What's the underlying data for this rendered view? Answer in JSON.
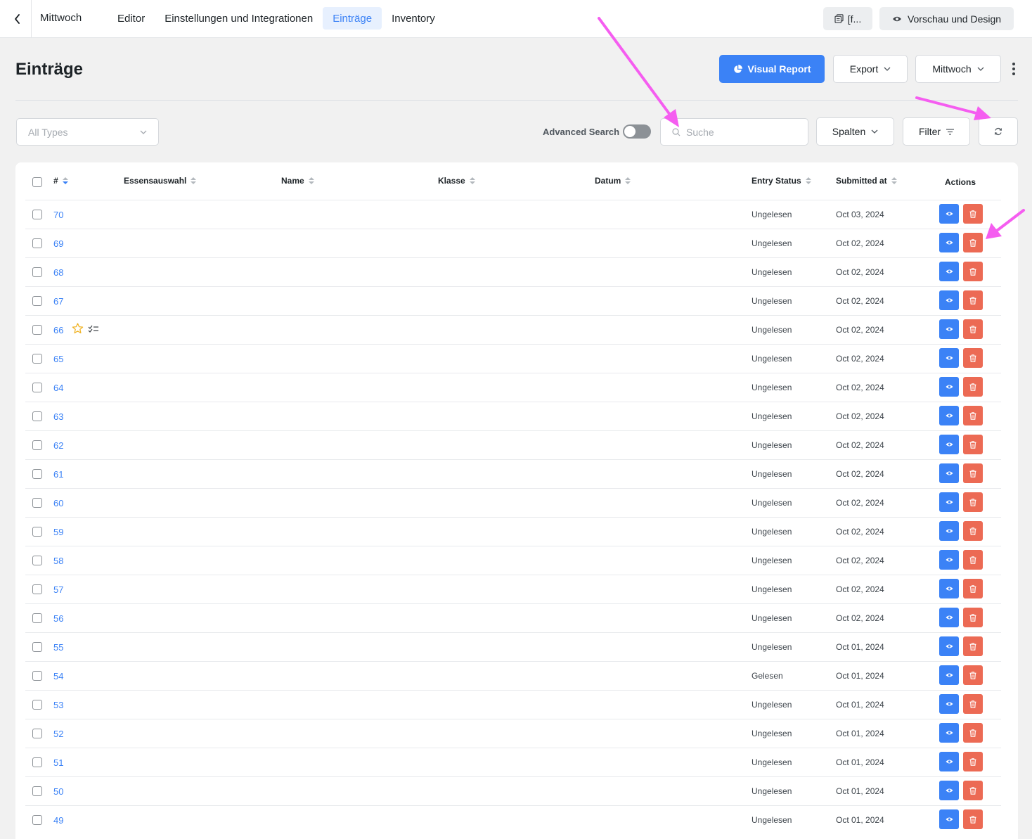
{
  "topbar": {
    "form_name": "Mittwoch",
    "nav": [
      {
        "label": "Editor",
        "active": false
      },
      {
        "label": "Einstellungen und Integrationen",
        "active": false
      },
      {
        "label": "Einträge",
        "active": true
      },
      {
        "label": "Inventory",
        "active": false
      }
    ],
    "shortcode_label": "[f...",
    "preview_label": "Vorschau und Design"
  },
  "header": {
    "title": "Einträge",
    "visual_report_label": "Visual Report",
    "export_label": "Export",
    "form_select_label": "Mittwoch"
  },
  "filters": {
    "types_placeholder": "All Types",
    "advanced_search_label": "Advanced Search",
    "search_placeholder": "Suche",
    "columns_label": "Spalten",
    "filter_label": "Filter"
  },
  "table": {
    "columns": {
      "id": "#",
      "essensauswahl": "Essensauswahl",
      "name": "Name",
      "klasse": "Klasse",
      "datum": "Datum",
      "entry_status": "Entry Status",
      "submitted_at": "Submitted at",
      "actions": "Actions"
    },
    "rows": [
      {
        "id": "70",
        "status": "Ungelesen",
        "submitted": "Oct 03, 2024"
      },
      {
        "id": "69",
        "status": "Ungelesen",
        "submitted": "Oct 02, 2024"
      },
      {
        "id": "68",
        "status": "Ungelesen",
        "submitted": "Oct 02, 2024"
      },
      {
        "id": "67",
        "status": "Ungelesen",
        "submitted": "Oct 02, 2024"
      },
      {
        "id": "66",
        "status": "Ungelesen",
        "submitted": "Oct 02, 2024",
        "favorite_icon": "star-icon",
        "todo_icon": "checklist-icon"
      },
      {
        "id": "65",
        "status": "Ungelesen",
        "submitted": "Oct 02, 2024"
      },
      {
        "id": "64",
        "status": "Ungelesen",
        "submitted": "Oct 02, 2024"
      },
      {
        "id": "63",
        "status": "Ungelesen",
        "submitted": "Oct 02, 2024"
      },
      {
        "id": "62",
        "status": "Ungelesen",
        "submitted": "Oct 02, 2024"
      },
      {
        "id": "61",
        "status": "Ungelesen",
        "submitted": "Oct 02, 2024"
      },
      {
        "id": "60",
        "status": "Ungelesen",
        "submitted": "Oct 02, 2024"
      },
      {
        "id": "59",
        "status": "Ungelesen",
        "submitted": "Oct 02, 2024"
      },
      {
        "id": "58",
        "status": "Ungelesen",
        "submitted": "Oct 02, 2024"
      },
      {
        "id": "57",
        "status": "Ungelesen",
        "submitted": "Oct 02, 2024"
      },
      {
        "id": "56",
        "status": "Ungelesen",
        "submitted": "Oct 02, 2024"
      },
      {
        "id": "55",
        "status": "Ungelesen",
        "submitted": "Oct 01, 2024"
      },
      {
        "id": "54",
        "status": "Gelesen",
        "submitted": "Oct 01, 2024"
      },
      {
        "id": "53",
        "status": "Ungelesen",
        "submitted": "Oct 01, 2024"
      },
      {
        "id": "52",
        "status": "Ungelesen",
        "submitted": "Oct 01, 2024"
      },
      {
        "id": "51",
        "status": "Ungelesen",
        "submitted": "Oct 01, 2024"
      },
      {
        "id": "50",
        "status": "Ungelesen",
        "submitted": "Oct 01, 2024"
      },
      {
        "id": "49",
        "status": "Ungelesen",
        "submitted": "Oct 01, 2024"
      }
    ]
  },
  "colors": {
    "primary": "#3b82f6",
    "danger": "#ec6a54",
    "annotation": "#f55df0"
  }
}
